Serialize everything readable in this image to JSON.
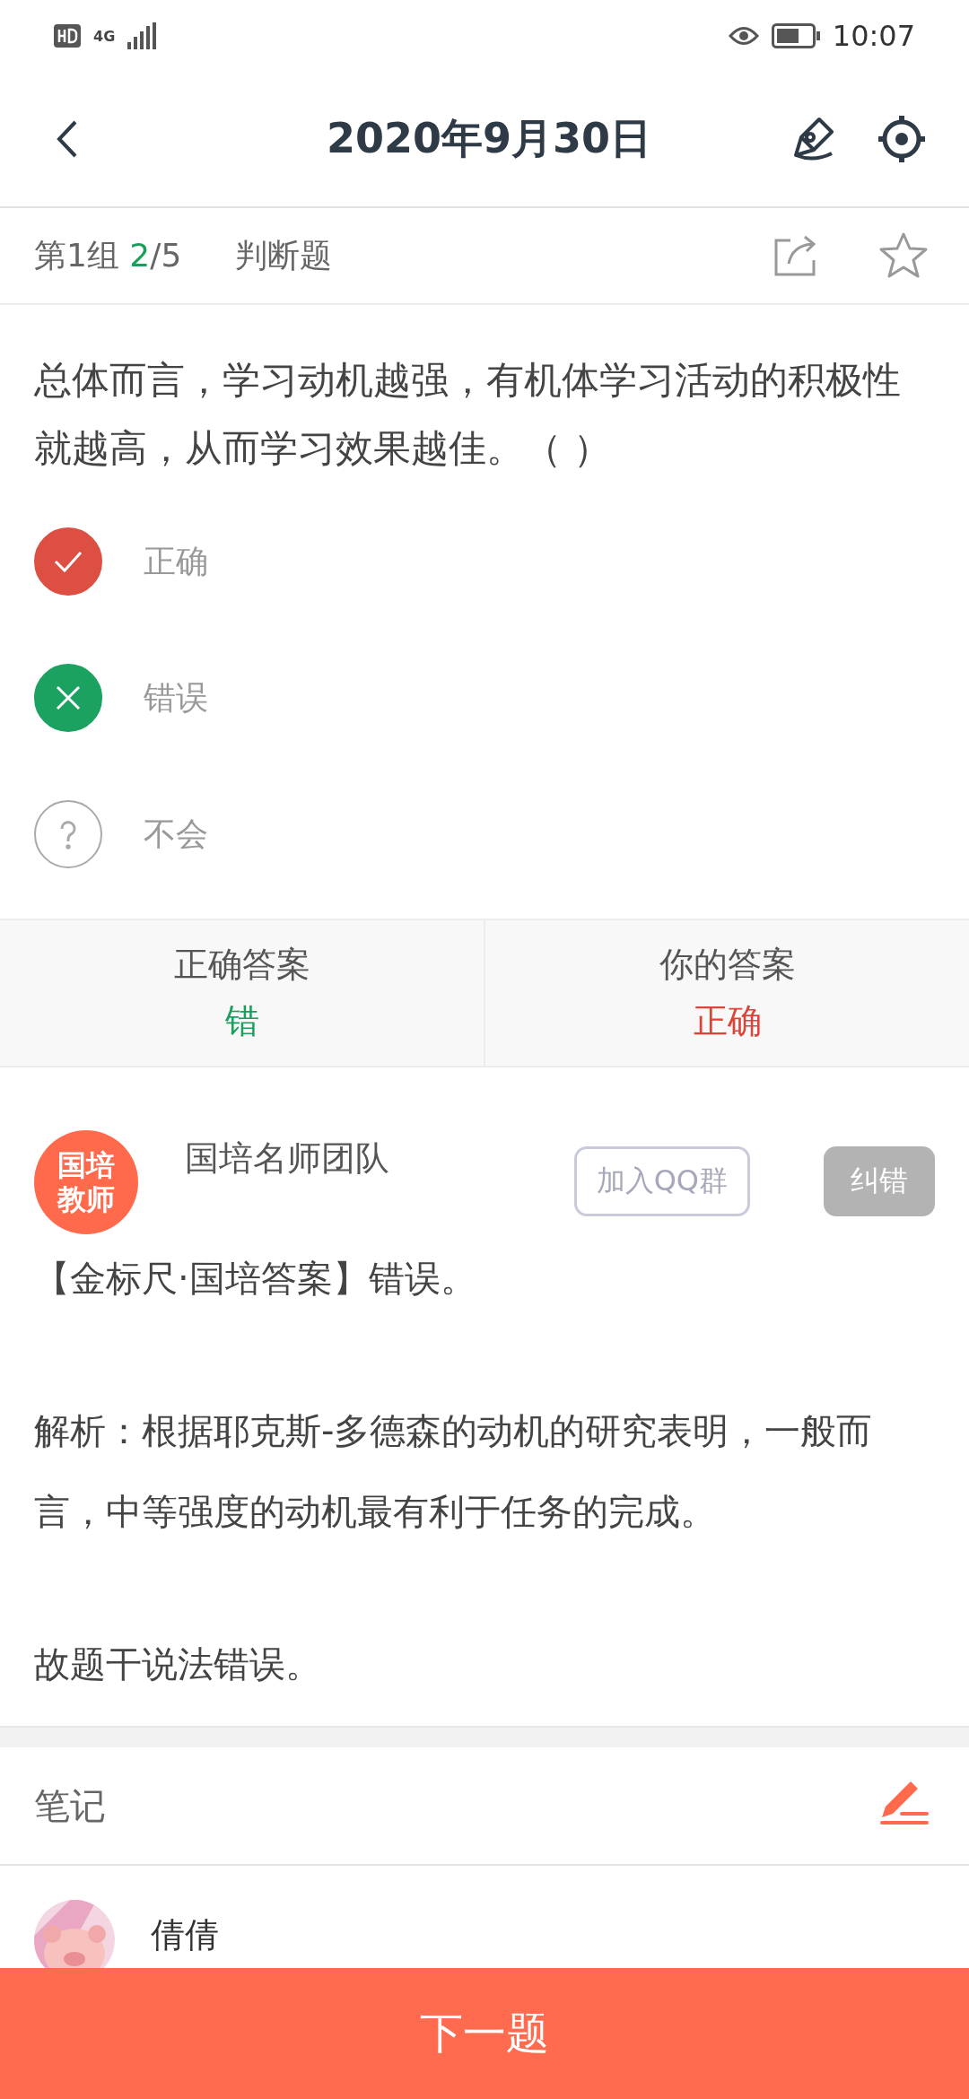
{
  "status_bar": {
    "network": "4G",
    "time": "10:07"
  },
  "header": {
    "title": "2020年9月30日"
  },
  "meta": {
    "group": "第1组",
    "current": "2",
    "total": "/5",
    "type": "判断题"
  },
  "question": {
    "text": "总体而言，学习动机越强，有机体学习活动的积极性就越高，从而学习效果越佳。（   ）"
  },
  "options": [
    {
      "label": "正确",
      "kind": "check",
      "selected": true,
      "correct": false
    },
    {
      "label": "错误",
      "kind": "cross",
      "selected": false,
      "correct": true
    },
    {
      "label": "不会",
      "kind": "question",
      "selected": false,
      "correct": false
    }
  ],
  "answers": [
    {
      "label": "正确答案",
      "value": "错",
      "correct": true
    },
    {
      "label": "你的答案",
      "value": "正确",
      "correct": false
    }
  ],
  "analysis": {
    "avatar_lines": [
      "国培",
      "教师"
    ],
    "author": "国培名师团队",
    "join_button": "加入QQ群",
    "report_button": "纠错",
    "paragraphs": [
      "【金标尺·国培答案】错误。",
      "解析：根据耶克斯-多德森的动机的研究表明，一般而言，中等强度的动机最有利于任务的完成。",
      "故题干说法错误。"
    ]
  },
  "notes": {
    "title": "笔记",
    "items": [
      {
        "author": "倩倩"
      }
    ]
  },
  "next_button": "下一题"
}
